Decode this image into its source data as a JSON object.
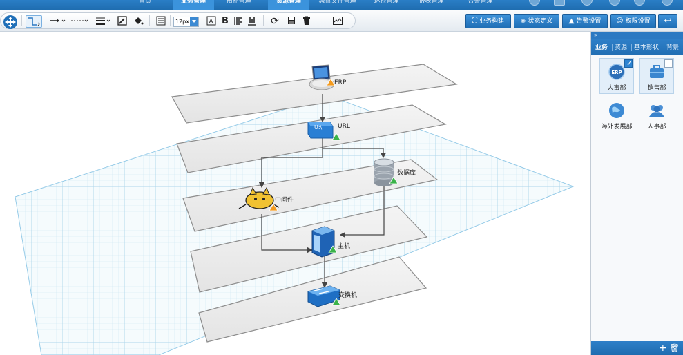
{
  "topnav": {
    "tabs": [
      {
        "label": "首页",
        "active": false
      },
      {
        "label": "业务管理",
        "active": true
      },
      {
        "label": "拓扑管理",
        "active": false
      },
      {
        "label": "资源管理",
        "active": true
      },
      {
        "label": "城盘文件管理",
        "active": false
      },
      {
        "label": "巡检管理",
        "active": false
      },
      {
        "label": "报表管理",
        "active": false
      },
      {
        "label": "告警管理",
        "active": false
      }
    ]
  },
  "toolbar": {
    "font_size": "12px",
    "buttons": {
      "biz_build": "业务构建",
      "state_def": "状态定义",
      "alarm_set": "告警设置",
      "perm_set": "权限设置"
    }
  },
  "diagram": {
    "nodes": {
      "erp": "ERP",
      "url": "URL",
      "db": "数据库",
      "mw": "中间件",
      "host": "主机",
      "switch": "交换机"
    },
    "url_chip": "U:\\"
  },
  "panel": {
    "tabs": [
      "业务",
      "资源",
      "基本形状",
      "背景"
    ],
    "items": [
      {
        "label": "人事部",
        "badge": "ERP",
        "checked": true,
        "selected": true
      },
      {
        "label": "销售部",
        "checked": false,
        "selected": true
      },
      {
        "label": "海外发展部",
        "selected": false
      },
      {
        "label": "人事部",
        "selected": false
      }
    ]
  },
  "colors": {
    "accent": "#2b79c2",
    "grid": "#b9dcef",
    "warn": "#f39a1e",
    "ok": "#3bb34a"
  }
}
